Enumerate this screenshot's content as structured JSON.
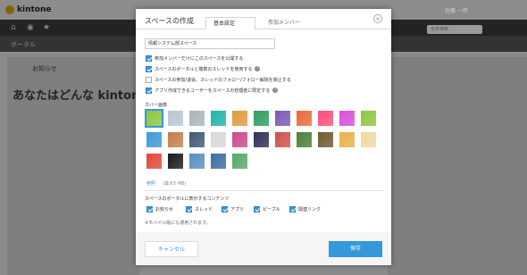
{
  "app": {
    "logo": "kintone",
    "user_name": "佐藤 一郎",
    "search_placeholder": "全体検索"
  },
  "background": {
    "portal_label": "ポータル",
    "notice_title": "お知らせ",
    "hero_text": "あなたはどんな kintone"
  },
  "dialog": {
    "title": "スペースの作成",
    "tabs": [
      {
        "label": "基本設定",
        "active": true
      },
      {
        "label": "参加メンバー",
        "active": false
      }
    ],
    "space_name": "情報システム部スペース",
    "options": [
      {
        "label": "参加メンバーだけにこのスペースを公開する",
        "checked": true,
        "help": false
      },
      {
        "label": "スペースのポータルと複数のスレッドを使用する",
        "checked": true,
        "help": true
      },
      {
        "label": "スペースの参加/退会、スレッドのフォロー/フォロー解除を禁止する",
        "checked": false,
        "help": false
      },
      {
        "label": "アプリ作成できるユーザーをスペースの管理者に限定する",
        "checked": true,
        "help": true
      }
    ],
    "cover_label": "カバー画像",
    "cover_colors": [
      "#8cc63f",
      "#b8c7cf",
      "#aab4bd",
      "#20b2aa",
      "#e09b3d",
      "#2e9e5e",
      "#7d59b6",
      "#e86a3a",
      "#ff4f7b",
      "#d94fd9",
      "#8cc63f",
      "#3a9ad9",
      "#c27f4b",
      "#3f5a72",
      "#d8d8d8",
      "#c94c8c",
      "#2f2f5a",
      "#d0504a",
      "#4a7f3a",
      "#6e5a2e",
      "#e9b14a",
      "#f0d9a0",
      "#e2473a",
      "#1a1a1a",
      "#5a8fbf",
      "#3a6e9e",
      "#56a86a"
    ],
    "selected_cover": 0,
    "upload_link": "参照",
    "upload_limit": "(最大5 MB)",
    "display_label": "スペースのポータルに表示するコンテンツ",
    "display_items": [
      {
        "label": "お知らせ",
        "checked": true
      },
      {
        "label": "スレッド",
        "checked": true
      },
      {
        "label": "アプリ",
        "checked": true
      },
      {
        "label": "ピープル",
        "checked": true
      },
      {
        "label": "関連リンク",
        "checked": true
      }
    ],
    "note": "※モバイル版にも適用されます。",
    "cancel": "キャンセル",
    "save": "保存"
  }
}
